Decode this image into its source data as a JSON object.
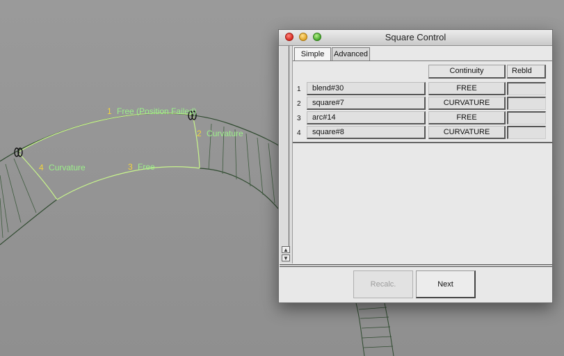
{
  "viewport": {
    "labels": {
      "free_position_failed": {
        "num": "1",
        "text": "Free (Position Failed)"
      },
      "curvature_right": {
        "num": "2",
        "text": "Curvature"
      },
      "free_bottom": {
        "num": "3",
        "text": "Free"
      },
      "curvature_left": {
        "num": "4",
        "text": "Curvature"
      }
    },
    "colors": {
      "num": "#f2d53d",
      "label": "#9cf08a",
      "curve": "#c8f58c",
      "surface": "#2f4a2f"
    }
  },
  "window": {
    "title": "Square Control",
    "tabs": [
      {
        "label": "Simple",
        "active": true
      },
      {
        "label": "Advanced",
        "active": false
      }
    ],
    "columns": {
      "continuity": "Continuity",
      "rebuild": "Rebld"
    },
    "rows": [
      {
        "num": "1",
        "name": "blend#30",
        "continuity": "FREE"
      },
      {
        "num": "2",
        "name": "square#7",
        "continuity": "CURVATURE"
      },
      {
        "num": "3",
        "name": "arc#14",
        "continuity": "FREE"
      },
      {
        "num": "4",
        "name": "square#8",
        "continuity": "CURVATURE"
      }
    ],
    "buttons": {
      "recalc": "Recalc.",
      "next": "Next"
    }
  }
}
